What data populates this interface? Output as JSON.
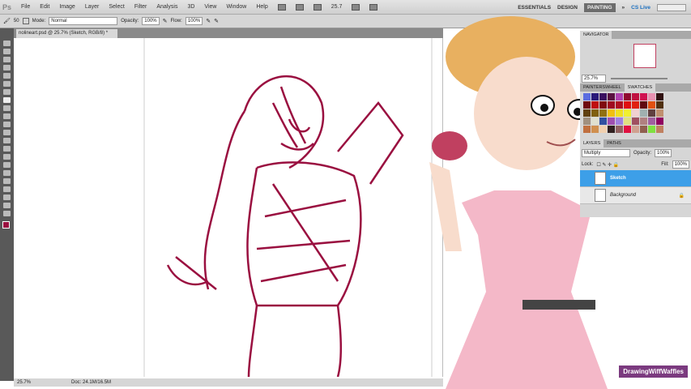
{
  "menu": {
    "logo": "Ps",
    "items": [
      "File",
      "Edit",
      "Image",
      "Layer",
      "Select",
      "Filter",
      "Analysis",
      "3D",
      "View",
      "Window",
      "Help"
    ],
    "zoom": "25.7"
  },
  "options": {
    "brush_size": "50",
    "mode_label": "Mode:",
    "mode": "Normal",
    "opacity_label": "Opacity:",
    "opacity": "100%",
    "flow_label": "Flow:",
    "flow": "100%"
  },
  "workspace": {
    "items": [
      "ESSENTIALS",
      "DESIGN",
      "PAINTING"
    ],
    "active": "PAINTING",
    "more": "»",
    "cslive": "CS Live"
  },
  "document": {
    "tab": "nolineart.psd @ 25.7% (Sketch, RGB/8) *",
    "zoom": "25.7%",
    "doc_info": "Doc: 24.1M/16.5M"
  },
  "navigator": {
    "title": "NAVIGATOR",
    "zoom": "25.7%"
  },
  "swatches": {
    "tabs": [
      "PAINTERSWHEEL",
      "SWATCHES"
    ],
    "colors": [
      "#5a6de0",
      "#2a1a7a",
      "#3a1060",
      "#5a1040",
      "#b040b0",
      "#900a30",
      "#c01040",
      "#d01050",
      "#e890b0",
      "#301010",
      "#700a10",
      "#c01010",
      "#800a10",
      "#a00a20",
      "#b01020",
      "#e01010",
      "#e02010",
      "#600810",
      "#e05010",
      "#503010",
      "#604010",
      "#806010",
      "#907010",
      "#f0c010",
      "#f0e020",
      "#f0f030",
      "#f0d0d0",
      "#a0b0b0",
      "#604040",
      "#c09070",
      "#a09080",
      "#e0e0d0",
      "#3050a0",
      "#a050b0",
      "#a080e0",
      "#e0e080",
      "#a05060",
      "#b08080",
      "#a060a0",
      "#900060",
      "#c07040",
      "#d09050",
      "#f0d0b0",
      "#302020",
      "#906060",
      "#e01040",
      "#d0a090",
      "#906050",
      "#80e040",
      "#c08060"
    ]
  },
  "layers": {
    "tabs": [
      "LAYERS",
      "PATHS"
    ],
    "blend_mode": "Multiply",
    "opacity_label": "Opacity:",
    "opacity": "100%",
    "lock_label": "Lock:",
    "fill_label": "Fill:",
    "fill": "100%",
    "items": [
      {
        "name": "Sketch",
        "selected": true
      },
      {
        "name": "Background",
        "selected": false
      }
    ]
  },
  "watermark": "DrawingWiffWaffles",
  "colors": {
    "sketch": "#9a1040",
    "accent": "#3d9fe8"
  }
}
